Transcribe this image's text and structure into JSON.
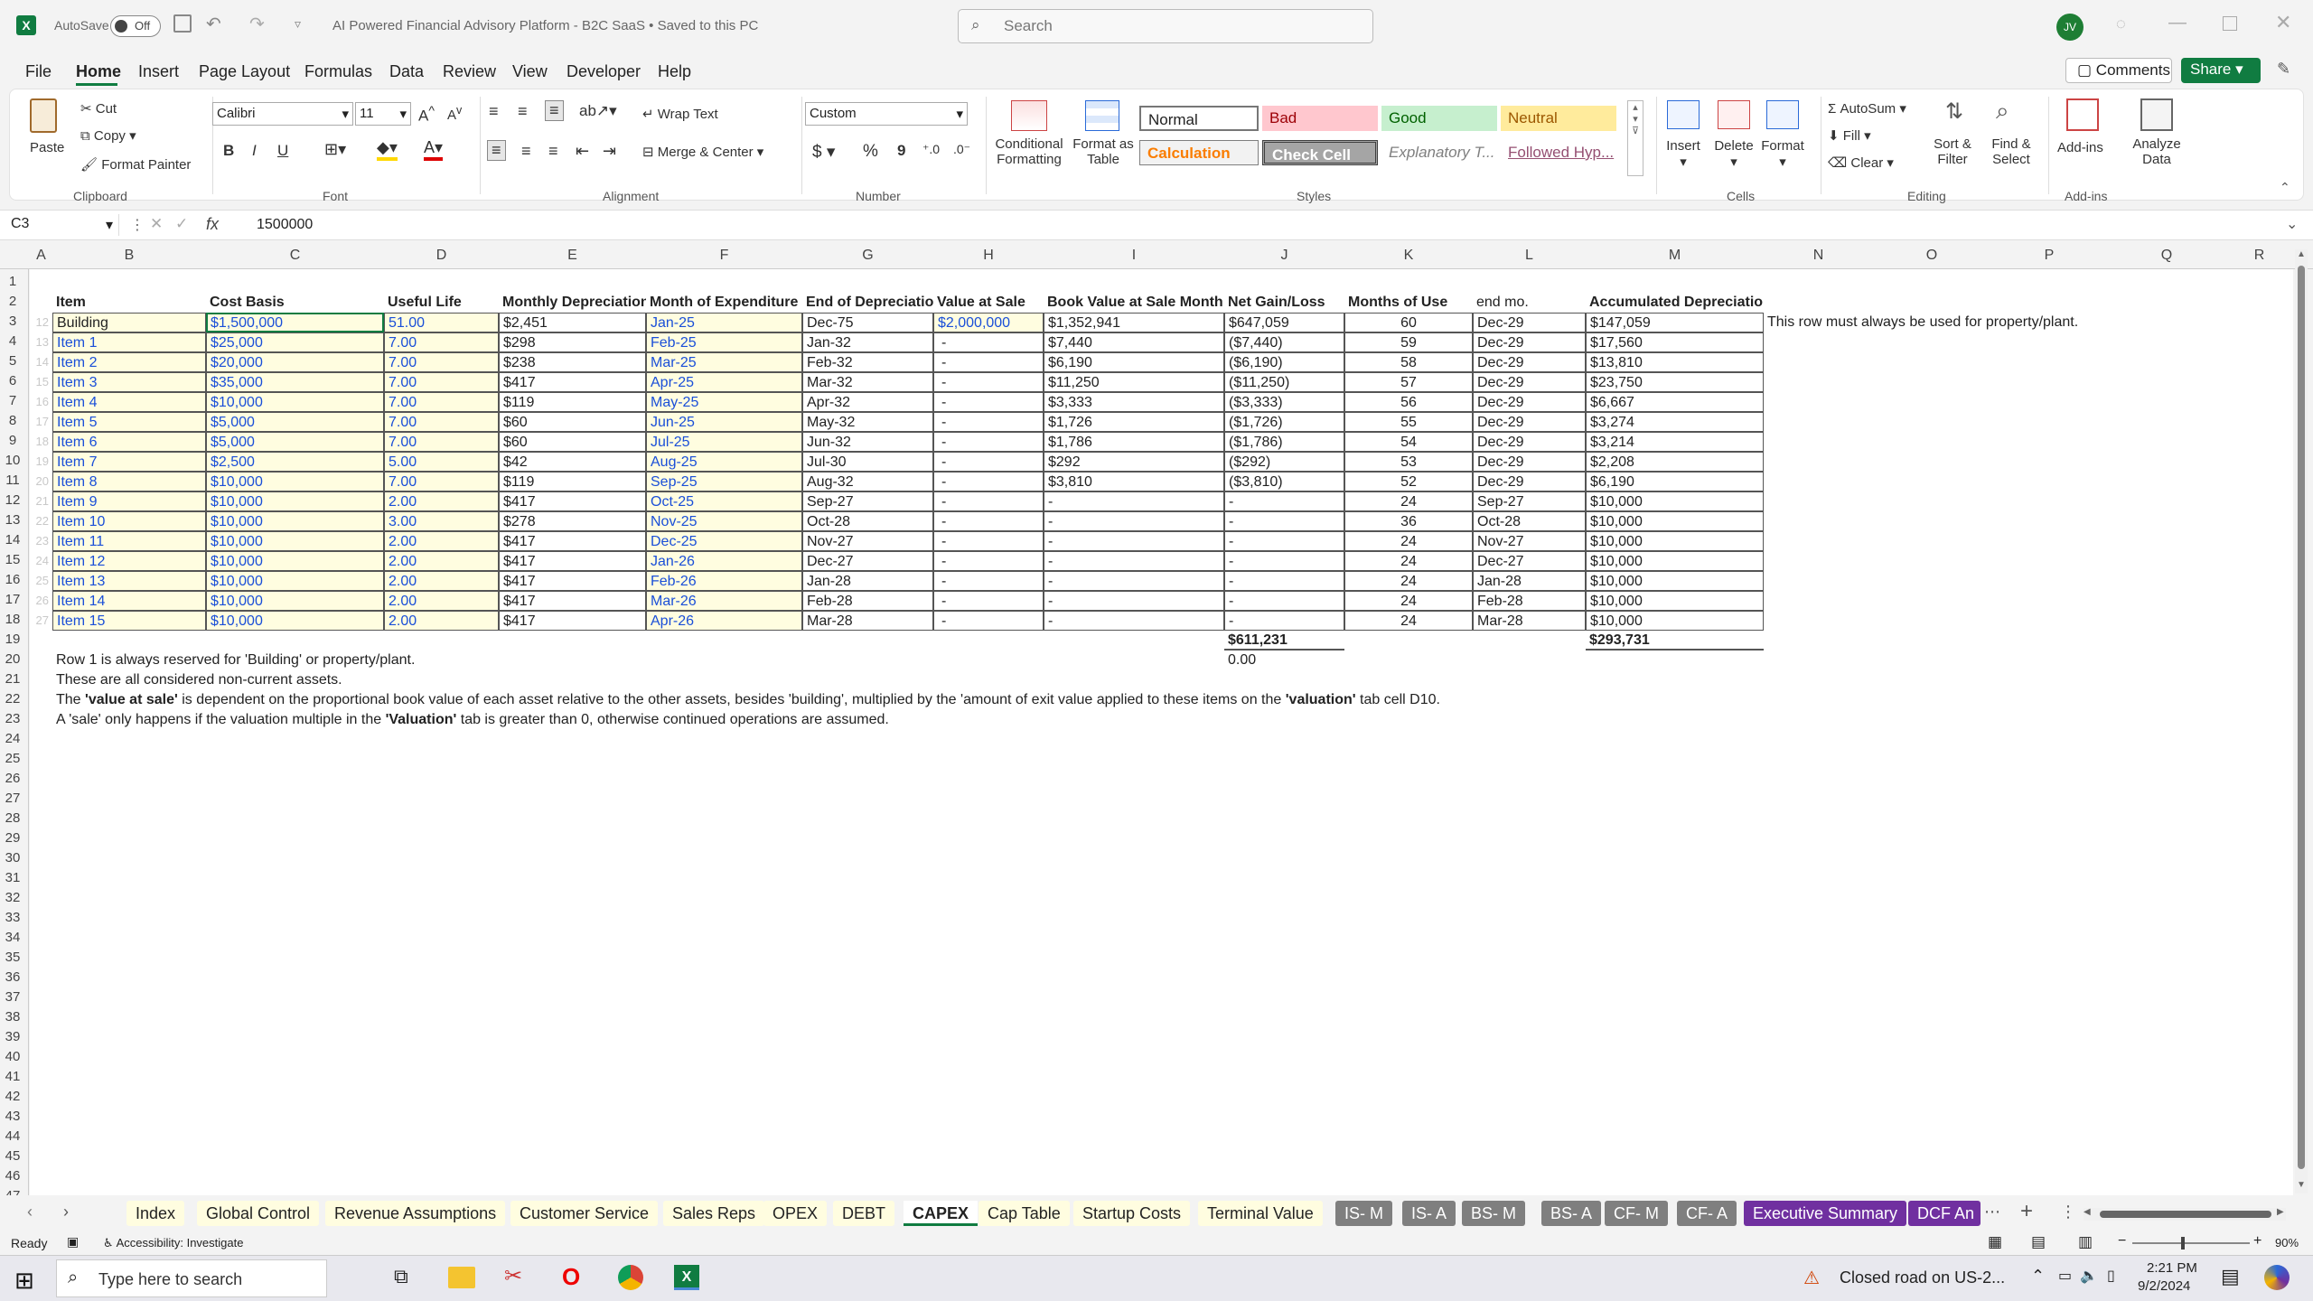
{
  "app": {
    "autosave_label": "AutoSave",
    "autosave_state": "Off",
    "doc_title": "AI Powered Financial Advisory Platform - B2C SaaS",
    "save_state": "Saved to this PC",
    "search_placeholder": "Search",
    "user_initials": "JV"
  },
  "menu": [
    "File",
    "Home",
    "Insert",
    "Page Layout",
    "Formulas",
    "Data",
    "Review",
    "View",
    "Developer",
    "Help"
  ],
  "menu_active": "Home",
  "header_buttons": {
    "comments": "Comments",
    "share": "Share"
  },
  "ribbon": {
    "clipboard": {
      "paste": "Paste",
      "cut": "Cut",
      "copy": "Copy",
      "format_painter": "Format Painter",
      "group": "Clipboard"
    },
    "font": {
      "family": "Calibri",
      "size": "11",
      "group": "Font",
      "bold": "B",
      "italic": "I",
      "underline": "U"
    },
    "alignment": {
      "wrap": "Wrap Text",
      "merge": "Merge & Center",
      "group": "Alignment"
    },
    "number": {
      "format": "Custom",
      "group": "Number",
      "currency": "$",
      "percent": "%",
      "comma": "9"
    },
    "styles": {
      "cond_fmt": "Conditional Formatting",
      "format_table": "Format as Table",
      "normal": "Normal",
      "bad": "Bad",
      "good": "Good",
      "neutral": "Neutral",
      "calculation": "Calculation",
      "check_cell": "Check Cell",
      "explanatory": "Explanatory T...",
      "followed": "Followed Hyp...",
      "group": "Styles"
    },
    "cells": {
      "insert": "Insert",
      "delete": "Delete",
      "format": "Format",
      "group": "Cells"
    },
    "editing": {
      "autosum": "AutoSum",
      "fill": "Fill",
      "clear": "Clear",
      "sort": "Sort & Filter",
      "find": "Find & Select",
      "group": "Editing"
    },
    "addins": {
      "addins": "Add-ins",
      "analyze": "Analyze Data",
      "group": "Add-ins"
    }
  },
  "formula_bar": {
    "name_box": "C3",
    "fx": "fx",
    "value": "1500000"
  },
  "columns": [
    "A",
    "B",
    "C",
    "D",
    "E",
    "F",
    "G",
    "H",
    "I",
    "J",
    "K",
    "L",
    "M",
    "N",
    "O",
    "P",
    "Q",
    "R"
  ],
  "sheet": {
    "headers": [
      "Item",
      "Cost Basis",
      "Useful Life",
      "Monthly Depreciation",
      "Month of Expenditure",
      "End of Depreciation",
      "Value at Sale",
      "Book Value at Sale Month",
      "Net Gain/Loss",
      "Months of Use",
      "end mo.",
      "Accumulated Depreciation"
    ],
    "rows": [
      {
        "n": "12",
        "item": "Building",
        "cost": "$1,500,000",
        "life": "51.00",
        "monthly": "$2,451",
        "month": "Jan-25",
        "end": "Dec-75",
        "sale": "$2,000,000",
        "book": "$1,352,941",
        "gain": "$647,059",
        "use": "60",
        "endmo": "Dec-29",
        "acc": "$147,059"
      },
      {
        "n": "13",
        "item": "Item 1",
        "cost": "$25,000",
        "life": "7.00",
        "monthly": "$298",
        "month": "Feb-25",
        "end": "Jan-32",
        "sale": "-",
        "book": "$7,440",
        "gain": "($7,440)",
        "use": "59",
        "endmo": "Dec-29",
        "acc": "$17,560"
      },
      {
        "n": "14",
        "item": "Item 2",
        "cost": "$20,000",
        "life": "7.00",
        "monthly": "$238",
        "month": "Mar-25",
        "end": "Feb-32",
        "sale": "-",
        "book": "$6,190",
        "gain": "($6,190)",
        "use": "58",
        "endmo": "Dec-29",
        "acc": "$13,810"
      },
      {
        "n": "15",
        "item": "Item 3",
        "cost": "$35,000",
        "life": "7.00",
        "monthly": "$417",
        "month": "Apr-25",
        "end": "Mar-32",
        "sale": "-",
        "book": "$11,250",
        "gain": "($11,250)",
        "use": "57",
        "endmo": "Dec-29",
        "acc": "$23,750"
      },
      {
        "n": "16",
        "item": "Item 4",
        "cost": "$10,000",
        "life": "7.00",
        "monthly": "$119",
        "month": "May-25",
        "end": "Apr-32",
        "sale": "-",
        "book": "$3,333",
        "gain": "($3,333)",
        "use": "56",
        "endmo": "Dec-29",
        "acc": "$6,667"
      },
      {
        "n": "17",
        "item": "Item 5",
        "cost": "$5,000",
        "life": "7.00",
        "monthly": "$60",
        "month": "Jun-25",
        "end": "May-32",
        "sale": "-",
        "book": "$1,726",
        "gain": "($1,726)",
        "use": "55",
        "endmo": "Dec-29",
        "acc": "$3,274"
      },
      {
        "n": "18",
        "item": "Item 6",
        "cost": "$5,000",
        "life": "7.00",
        "monthly": "$60",
        "month": "Jul-25",
        "end": "Jun-32",
        "sale": "-",
        "book": "$1,786",
        "gain": "($1,786)",
        "use": "54",
        "endmo": "Dec-29",
        "acc": "$3,214"
      },
      {
        "n": "19",
        "item": "Item 7",
        "cost": "$2,500",
        "life": "5.00",
        "monthly": "$42",
        "month": "Aug-25",
        "end": "Jul-30",
        "sale": "-",
        "book": "$292",
        "gain": "($292)",
        "use": "53",
        "endmo": "Dec-29",
        "acc": "$2,208"
      },
      {
        "n": "20",
        "item": "Item 8",
        "cost": "$10,000",
        "life": "7.00",
        "monthly": "$119",
        "month": "Sep-25",
        "end": "Aug-32",
        "sale": "-",
        "book": "$3,810",
        "gain": "($3,810)",
        "use": "52",
        "endmo": "Dec-29",
        "acc": "$6,190"
      },
      {
        "n": "21",
        "item": "Item 9",
        "cost": "$10,000",
        "life": "2.00",
        "monthly": "$417",
        "month": "Oct-25",
        "end": "Sep-27",
        "sale": "-",
        "book": "-",
        "gain": "-",
        "use": "24",
        "endmo": "Sep-27",
        "acc": "$10,000"
      },
      {
        "n": "22",
        "item": "Item 10",
        "cost": "$10,000",
        "life": "3.00",
        "monthly": "$278",
        "month": "Nov-25",
        "end": "Oct-28",
        "sale": "-",
        "book": "-",
        "gain": "-",
        "use": "36",
        "endmo": "Oct-28",
        "acc": "$10,000"
      },
      {
        "n": "23",
        "item": "Item 11",
        "cost": "$10,000",
        "life": "2.00",
        "monthly": "$417",
        "month": "Dec-25",
        "end": "Nov-27",
        "sale": "-",
        "book": "-",
        "gain": "-",
        "use": "24",
        "endmo": "Nov-27",
        "acc": "$10,000"
      },
      {
        "n": "24",
        "item": "Item 12",
        "cost": "$10,000",
        "life": "2.00",
        "monthly": "$417",
        "month": "Jan-26",
        "end": "Dec-27",
        "sale": "-",
        "book": "-",
        "gain": "-",
        "use": "24",
        "endmo": "Dec-27",
        "acc": "$10,000"
      },
      {
        "n": "25",
        "item": "Item 13",
        "cost": "$10,000",
        "life": "2.00",
        "monthly": "$417",
        "month": "Feb-26",
        "end": "Jan-28",
        "sale": "-",
        "book": "-",
        "gain": "-",
        "use": "24",
        "endmo": "Jan-28",
        "acc": "$10,000"
      },
      {
        "n": "26",
        "item": "Item 14",
        "cost": "$10,000",
        "life": "2.00",
        "monthly": "$417",
        "month": "Mar-26",
        "end": "Feb-28",
        "sale": "-",
        "book": "-",
        "gain": "-",
        "use": "24",
        "endmo": "Feb-28",
        "acc": "$10,000"
      },
      {
        "n": "27",
        "item": "Item 15",
        "cost": "$10,000",
        "life": "2.00",
        "monthly": "$417",
        "month": "Apr-26",
        "end": "Mar-28",
        "sale": "-",
        "book": "-",
        "gain": "-",
        "use": "24",
        "endmo": "Mar-28",
        "acc": "$10,000"
      }
    ],
    "side_note": "This row must always be used for property/plant.",
    "totals": {
      "gain": "$611,231",
      "acc": "$293,731",
      "zero": "0.00"
    },
    "notes": [
      [
        "Row 1 is always reserved for 'Building' or property/plant."
      ],
      [
        "These are all considered non-current assets."
      ],
      [
        "The ",
        {
          "b": "'value at sale'"
        },
        " is dependent on the proportional book value of each asset relative to the other assets, besides 'building', multiplied by the 'amount of exit value applied to these items on the ",
        {
          "b": "'valuation'"
        },
        " tab cell D10."
      ],
      [
        "A 'sale' only happens if the valuation multiple in the ",
        {
          "b": "'Valuation'"
        },
        " tab is greater than 0, otherwise continued operations are assumed."
      ]
    ]
  },
  "sheet_tabs": [
    {
      "name": "Index",
      "bg": "#fffde0",
      "fg": "#222"
    },
    {
      "name": "Global Control",
      "bg": "#fffde0",
      "fg": "#222"
    },
    {
      "name": "Revenue Assumptions",
      "bg": "#fffde0",
      "fg": "#222"
    },
    {
      "name": "Customer Service",
      "bg": "#fffde0",
      "fg": "#222"
    },
    {
      "name": "Sales Reps",
      "bg": "#fffde0",
      "fg": "#222"
    },
    {
      "name": "OPEX",
      "bg": "#fffde0",
      "fg": "#222"
    },
    {
      "name": "DEBT",
      "bg": "#fffde0",
      "fg": "#222"
    },
    {
      "name": "CAPEX",
      "bg": "#ffffff",
      "fg": "#222",
      "active": true
    },
    {
      "name": "Cap Table",
      "bg": "#fffde0",
      "fg": "#222"
    },
    {
      "name": "Startup Costs",
      "bg": "#fffde0",
      "fg": "#222"
    },
    {
      "name": "Terminal Value",
      "bg": "#fffde0",
      "fg": "#222"
    },
    {
      "name": "IS- M",
      "bg": "#7f7f7f",
      "fg": "#fff"
    },
    {
      "name": "IS- A",
      "bg": "#7f7f7f",
      "fg": "#fff"
    },
    {
      "name": "BS- M",
      "bg": "#7f7f7f",
      "fg": "#fff"
    },
    {
      "name": "BS- A",
      "bg": "#7f7f7f",
      "fg": "#fff"
    },
    {
      "name": "CF- M",
      "bg": "#7f7f7f",
      "fg": "#fff"
    },
    {
      "name": "CF- A",
      "bg": "#7f7f7f",
      "fg": "#fff"
    },
    {
      "name": "Executive Summary",
      "bg": "#7030a0",
      "fg": "#fff"
    },
    {
      "name": "DCF An",
      "bg": "#7030a0",
      "fg": "#fff"
    }
  ],
  "status": {
    "ready": "Ready",
    "accessibility": "Accessibility: Investigate",
    "zoom": "90%"
  },
  "taskbar": {
    "search": "Type here to search",
    "notification": "Closed road on US-2...",
    "time": "2:21 PM",
    "date": "9/2/2024"
  },
  "colors": {
    "excel_green": "#107c41",
    "input_yellow": "#fffde0",
    "input_blue": "#1a4fd8",
    "purple_tab": "#7030a0",
    "gray_tab": "#7f7f7f"
  }
}
